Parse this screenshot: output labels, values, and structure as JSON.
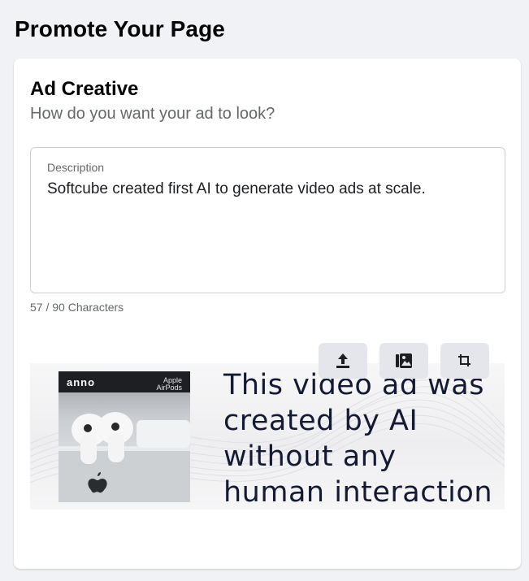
{
  "page": {
    "title": "Promote Your Page"
  },
  "ad_creative": {
    "title": "Ad Creative",
    "subtitle": "How do you want your ad to look?",
    "description": {
      "label": "Description",
      "value": "Softcube created first AI to generate video ads at scale.",
      "count": "57 / 90 Characters"
    },
    "preview": {
      "headline_lines": [
        "This video ad was",
        "created by AI",
        "without any",
        "human interaction"
      ],
      "brand": "anno",
      "product_name": [
        "Apple",
        "AirPods"
      ]
    },
    "toolbar": {
      "upload_icon": "upload-icon",
      "image_icon": "image-gallery-icon",
      "crop_icon": "crop-icon"
    }
  }
}
